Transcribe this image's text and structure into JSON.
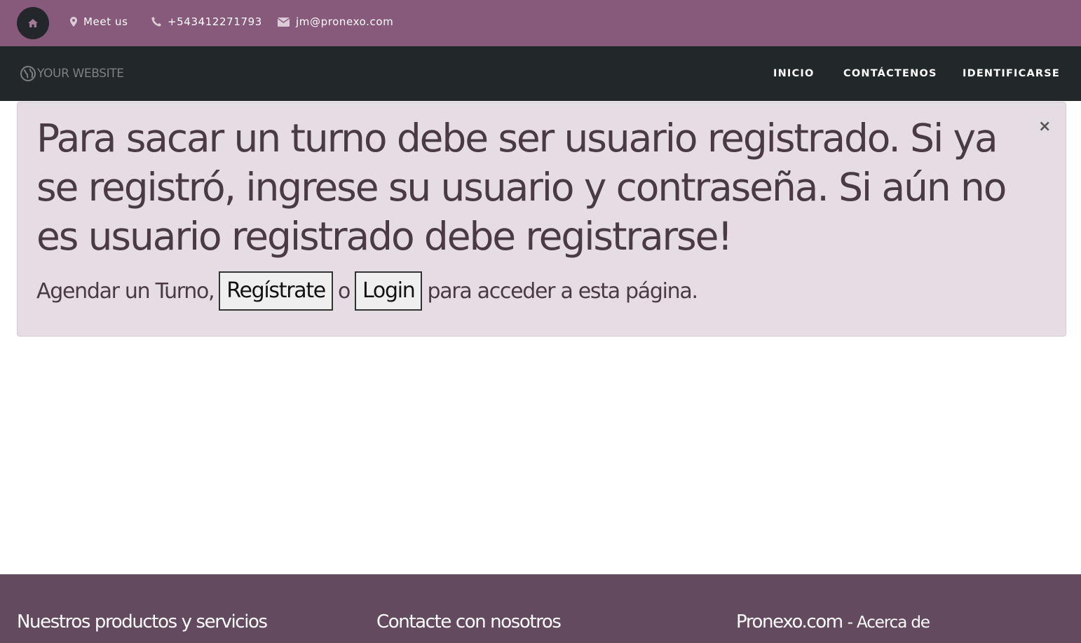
{
  "topbar": {
    "meet_label": "Meet us",
    "phone": "+543412271793",
    "email": "jm@pronexo.com"
  },
  "navbar": {
    "brand": "YOUR WEBSITE",
    "links": [
      "INICIO",
      "CONTÁCTENOS",
      "IDENTIFICARSE"
    ]
  },
  "alert": {
    "heading": "Para sacar un turno debe ser usuario registrado. Si ya se registró, ingrese su usuario y contraseña. Si aún no es usuario registrado debe registrarse!",
    "close": "×",
    "prefix": "Agendar un Turno,",
    "register_label": "Regístrate",
    "or": "o",
    "login_label": "Login",
    "suffix": "para acceder a esta página."
  },
  "footer": {
    "col1": "Nuestros productos y servicios",
    "col2": "Contacte con nosotros",
    "col3_title": "Pronexo.com",
    "col3_sub": "- Acerca de"
  },
  "colors": {
    "topbar": "#875a7b",
    "navbar": "#22272a",
    "alert_bg": "#e6dce3",
    "footer": "#634a5e"
  },
  "icons": [
    "home-icon",
    "map-marker-icon",
    "phone-icon",
    "envelope-icon",
    "globe-icon",
    "close-icon"
  ]
}
